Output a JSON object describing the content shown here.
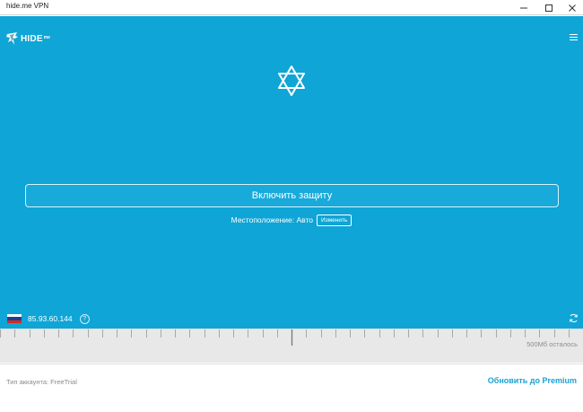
{
  "window": {
    "title": "hide.me VPN"
  },
  "header": {
    "logo_text": "HIDE",
    "logo_sub": "me",
    "logo_icon": "runner-icon",
    "menu_icon": "hamburger-menu-icon"
  },
  "center": {
    "status_icon": "star-of-david-icon",
    "connect_label": "Включить защиту",
    "location_label": "Местоположение: Авто",
    "change_label": "Изменить"
  },
  "status_bar": {
    "ip_address": "85.93.60.144",
    "help_label": "?",
    "flag_colors": [
      "#ffffff",
      "#1c3f94",
      "#d52b1e"
    ]
  },
  "usage": {
    "remaining_label": "500Мб осталось"
  },
  "footer": {
    "account_type": "Тип аккаунта: FreeTrial",
    "upgrade_label": "Обновить до Premium"
  },
  "colors": {
    "main_bg": "#0fa5d6",
    "accent": "#1aa2d4"
  }
}
